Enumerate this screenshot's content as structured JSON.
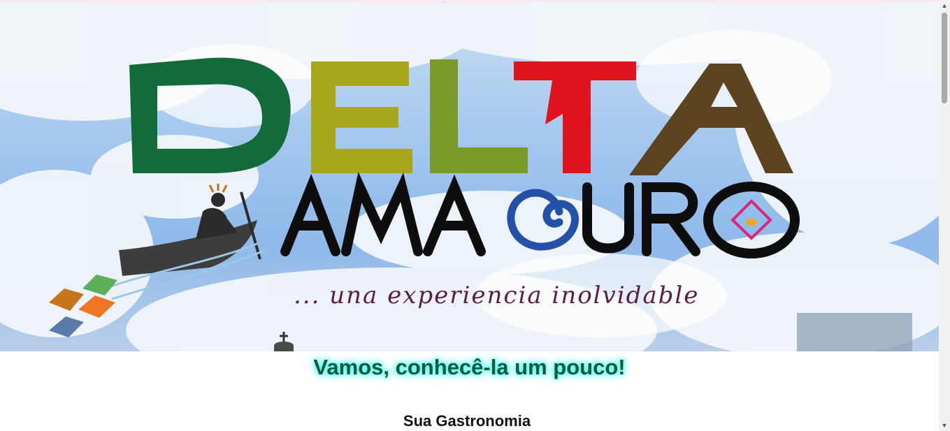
{
  "hero": {
    "logo_title": "DELTA",
    "logo_subtitle": "AMACURO",
    "logo_title_colors": [
      "#146b3a",
      "#a8a61c",
      "#7a9a2a",
      "#e0141e",
      "#5c4421"
    ],
    "tagline": "... una experiencia inolvidable"
  },
  "headline": "Vamos, conhecê-la um pouco!",
  "section_title": "Sua Gastronomia",
  "scrollbar": {
    "up_icon": "▲",
    "down_icon": "▼"
  },
  "colors": {
    "headline": "#0f5c3a",
    "headline_glow": "#4ff5f2",
    "tagline": "#5a1d43"
  }
}
